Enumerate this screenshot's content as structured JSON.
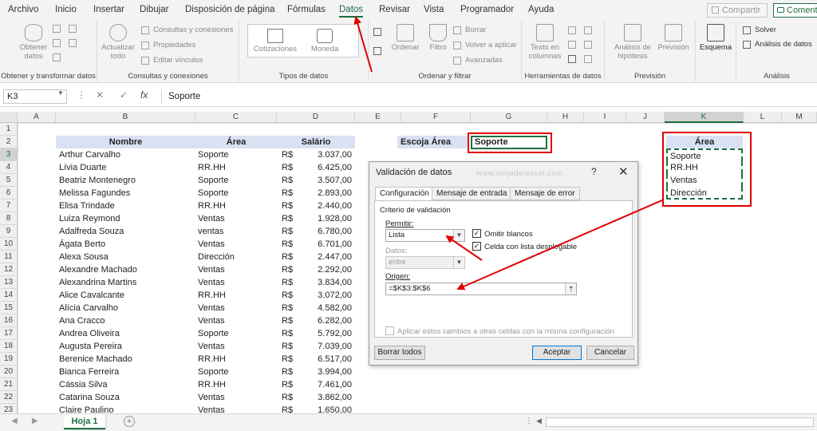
{
  "menu": [
    "Archivo",
    "Inicio",
    "Insertar",
    "Dibujar",
    "Disposición de página",
    "Fórmulas",
    "Datos",
    "Revisar",
    "Vista",
    "Programador",
    "Ayuda"
  ],
  "share_label": "Compartir",
  "comments_label": "Coment",
  "ribbon": {
    "obtener_datos": "Obtener datos",
    "group1": "Obtener y transformar datos",
    "actualizar": "Actualizar todo",
    "consultas": "Consultas y conexiones",
    "propiedades": "Propiedades",
    "editar_vinculos": "Editar vínculos",
    "group2": "Consultas y conexiones",
    "cotizaciones": "Cotizaciones",
    "moneda": "Moneda",
    "group3": "Tipos de datos",
    "ordenar": "Ordenar",
    "filtro": "Filtro",
    "borrar": "Borrar",
    "volver": "Volver a aplicar",
    "avanzadas": "Avanzadas",
    "group4": "Ordenar y filtrar",
    "texto_columnas": "Texto en columnas",
    "group5": "Herramientas de datos",
    "analisis_hipotesis": "Análisis de hipótesis",
    "prevision": "Previsión",
    "group6": "Previsión",
    "esquema": "Esquema",
    "solver": "Solver",
    "analisis_datos": "Análisis de datos",
    "group7": "Análisis"
  },
  "formula": {
    "namebox": "K3",
    "cancel": "✕",
    "enter": "✓",
    "fx": "fx",
    "value": "Soporte"
  },
  "columns": [
    "A",
    "B",
    "C",
    "D",
    "E",
    "F",
    "G",
    "H",
    "I",
    "J",
    "K",
    "L",
    "M"
  ],
  "rows": [
    "1",
    "2",
    "3",
    "4",
    "5",
    "6",
    "7",
    "8",
    "9",
    "10",
    "11",
    "12",
    "13",
    "14",
    "15",
    "16",
    "17",
    "18",
    "19",
    "20",
    "21",
    "22",
    "23"
  ],
  "table": {
    "headers": {
      "nombre": "Nombre",
      "area": "Área",
      "salario": "Salário"
    },
    "currency": "R$",
    "data": [
      [
        "Arthur Carvalho",
        "Soporte",
        "3.037,00"
      ],
      [
        "Lívia Duarte",
        "RR.HH",
        "6.425,00"
      ],
      [
        "Beatriz Montenegro",
        "Soporte",
        "3.507,00"
      ],
      [
        "Melissa Fagundes",
        "Soporte",
        "2.893,00"
      ],
      [
        "Elisa Trindade",
        "RR.HH",
        "2.440,00"
      ],
      [
        "Luiza Reymond",
        "Ventas",
        "1.928,00"
      ],
      [
        "Adalfreda Souza",
        "ventas",
        "6.780,00"
      ],
      [
        "Ágata Berto",
        "Ventas",
        "6.701,00"
      ],
      [
        "Alexa Sousa",
        "Dirección",
        "2.447,00"
      ],
      [
        "Alexandre Machado",
        "Ventas",
        "2.292,00"
      ],
      [
        "Alexandrina Martins",
        "Ventas",
        "3.834,00"
      ],
      [
        "Alice Cavalcante",
        "RR.HH",
        "3.072,00"
      ],
      [
        "Alícia Carvalho",
        "Ventas",
        "4.582,00"
      ],
      [
        "Ana Cracco",
        "Ventas",
        "6.282,00"
      ],
      [
        "Andrea Oliveira",
        "Soporte",
        "5.792,00"
      ],
      [
        "Augusta Pereira",
        "Ventas",
        "7.039,00"
      ],
      [
        "Berenice Machado",
        "RR.HH",
        "6.517,00"
      ],
      [
        "Bianca Ferreira",
        "Soporte",
        "3.994,00"
      ],
      [
        "Cássia Silva",
        "RR.HH",
        "7.461,00"
      ],
      [
        "Catarina Souza",
        "Ventas",
        "3.862,00"
      ],
      [
        "Claire Paulino",
        "Ventas",
        "1.650,00"
      ]
    ]
  },
  "escoja": {
    "label": "Escoja Área",
    "value": "Soporte"
  },
  "area_list": {
    "header": "Área",
    "items": [
      "Soporte",
      "RR.HH",
      "Ventas",
      "Dirección"
    ]
  },
  "dialog": {
    "title": "Validación de datos",
    "watermark": "www.ninjadelexcel.com",
    "help": "?",
    "close": "✕",
    "tabs": [
      "Configuración",
      "Mensaje de entrada",
      "Mensaje de error"
    ],
    "criterio": "Criterio de validación",
    "permitir_label": "Permitir:",
    "permitir_value": "Lista",
    "omitir": "Omitir blancos",
    "celda": "Celda con lista desplegable",
    "datos_label": "Datos:",
    "datos_value": "entre",
    "origen_label": "Origen:",
    "origen_value": "=$K$3:$K$6",
    "aplicar": "Aplicar estos cambios a otras celdas con la misma configuración",
    "borrar": "Borrar todos",
    "aceptar": "Aceptar",
    "cancelar": "Cancelar"
  },
  "sheet_tab": "Hoja 1",
  "colors": {
    "accent": "#1d6f42",
    "highlight": "#e00000",
    "header_fill": "#d9e1f2"
  }
}
